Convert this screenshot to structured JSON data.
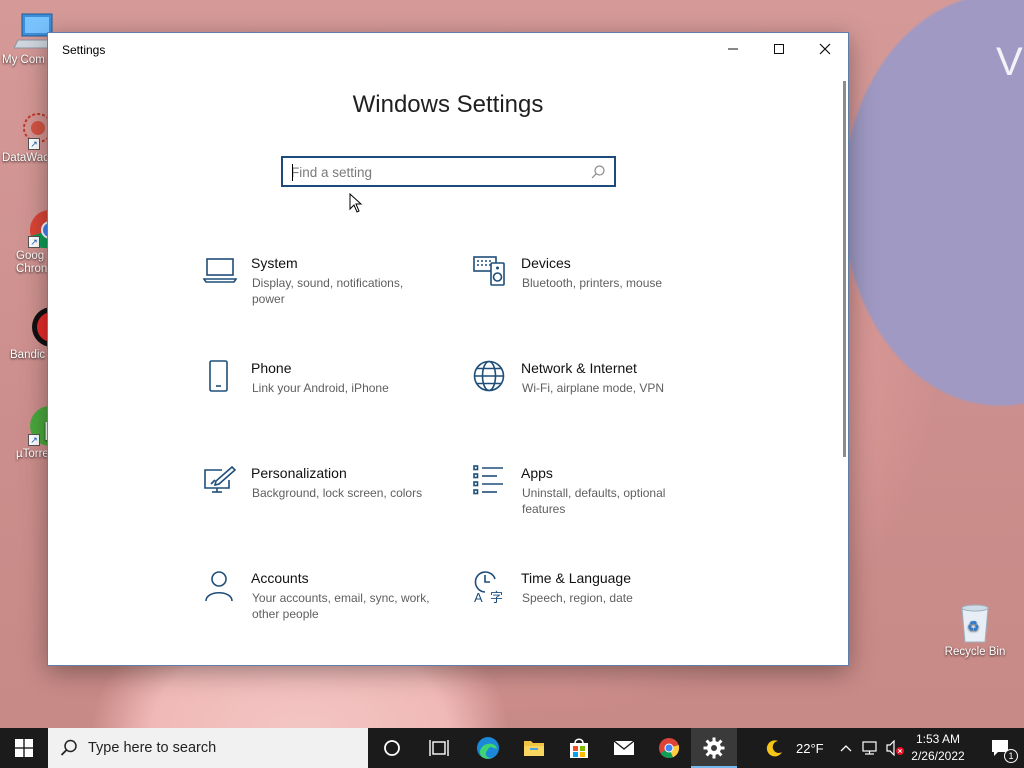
{
  "desktop": {
    "icons": [
      {
        "label": "My Com",
        "icon": "computer-icon"
      },
      {
        "label": "DataWac",
        "icon": "datawac-icon"
      },
      {
        "label": "Goog Chron",
        "icon": "chrome-icon"
      },
      {
        "label": "Bandic",
        "icon": "bandicam-icon"
      },
      {
        "label": "µTorre",
        "icon": "utorrent-icon"
      },
      {
        "label": "Recycle Bin",
        "icon": "recycle-bin-icon"
      }
    ]
  },
  "window": {
    "title": "Settings",
    "heading": "Windows Settings",
    "search_placeholder": "Find a setting",
    "tiles": [
      {
        "name": "System",
        "desc": "Display, sound, notifications, power",
        "icon": "laptop-icon"
      },
      {
        "name": "Devices",
        "desc": "Bluetooth, printers, mouse",
        "icon": "devices-icon"
      },
      {
        "name": "Phone",
        "desc": "Link your Android, iPhone",
        "icon": "phone-icon"
      },
      {
        "name": "Network & Internet",
        "desc": "Wi-Fi, airplane mode, VPN",
        "icon": "globe-icon"
      },
      {
        "name": "Personalization",
        "desc": "Background, lock screen, colors",
        "icon": "personalization-icon"
      },
      {
        "name": "Apps",
        "desc": "Uninstall, defaults, optional features",
        "icon": "apps-icon"
      },
      {
        "name": "Accounts",
        "desc": "Your accounts, email, sync, work, other people",
        "icon": "person-icon"
      },
      {
        "name": "Time & Language",
        "desc": "Speech, region, date",
        "icon": "time-language-icon"
      }
    ]
  },
  "taskbar": {
    "search_text": "Type here to search",
    "weather": "22°F",
    "time": "1:53 AM",
    "date": "2/26/2022",
    "notification_count": "1"
  },
  "colors": {
    "accent": "#1c4a7a",
    "icon_blue": "#1f4e79",
    "taskbar": "#1b1b1b"
  }
}
